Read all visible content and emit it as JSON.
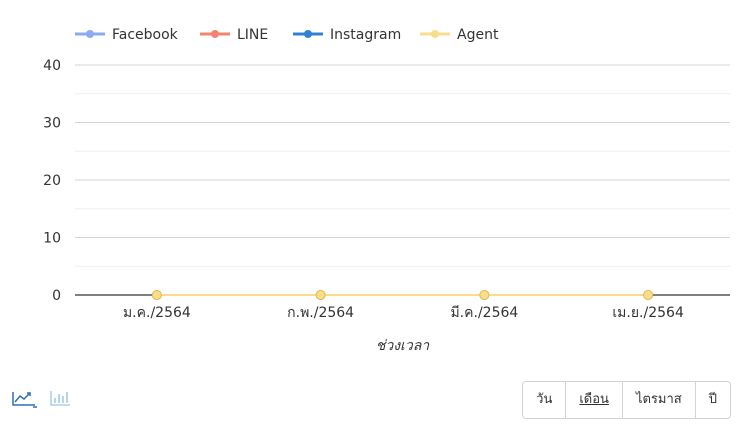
{
  "chart_data": {
    "type": "line",
    "categories": [
      "ม.ค./2564",
      "ก.พ./2564",
      "มี.ค./2564",
      "เม.ย./2564"
    ],
    "series": [
      {
        "name": "Facebook",
        "color": "#8fa8f5",
        "values": [
          0,
          0,
          0,
          0
        ]
      },
      {
        "name": "LINE",
        "color": "#f5836f",
        "values": [
          0,
          0,
          0,
          0
        ]
      },
      {
        "name": "Instagram",
        "color": "#2f80d6",
        "values": [
          0,
          0,
          0,
          0
        ]
      },
      {
        "name": "Agent",
        "color": "#f9dc8c",
        "values": [
          0,
          0,
          0,
          0
        ]
      }
    ],
    "y_ticks": [
      0,
      10,
      20,
      30,
      40
    ],
    "ylim": [
      0,
      40
    ],
    "xlabel": "ช่วงเวลา",
    "ylabel": "",
    "legend_position": "top-left",
    "grid": true
  },
  "toolbar": {
    "chart_types": [
      {
        "icon": "line-chart-icon",
        "color": "#2f6fb8",
        "active": true
      },
      {
        "icon": "bar-chart-icon",
        "color": "#9cc7e6",
        "active": false
      }
    ],
    "periods": [
      {
        "label": "วัน",
        "active": false
      },
      {
        "label": "เดือน",
        "active": true
      },
      {
        "label": "ไตรมาส",
        "active": false
      },
      {
        "label": "ปี",
        "active": false
      }
    ]
  }
}
